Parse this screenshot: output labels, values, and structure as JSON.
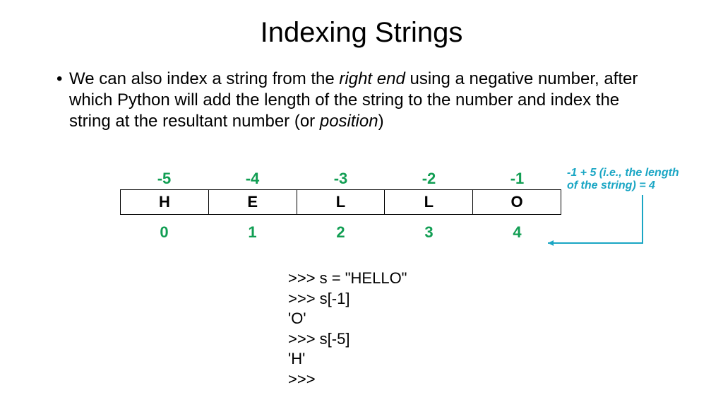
{
  "title": "Indexing Strings",
  "bullet": {
    "pre": "We can also index a string from the ",
    "em1": "right end",
    "mid": " using a negative number, after which Python will add the length of the string to the number and index the string at the resultant number (or ",
    "em2": "position",
    "post": ")"
  },
  "neg_indices": [
    "-5",
    "-4",
    "-3",
    "-2",
    "-1"
  ],
  "chars": [
    "H",
    "E",
    "L",
    "L",
    "O"
  ],
  "pos_indices": [
    "0",
    "1",
    "2",
    "3",
    "4"
  ],
  "annotation": {
    "l1": "-1 + 5 (i.e., the length",
    "l2": "of the string) = 4"
  },
  "code": {
    "l1": ">>> s = \"HELLO\"",
    "l2": ">>> s[-1]",
    "l3": "'O'",
    "l4": ">>> s[-5]",
    "l5": "'H'",
    "l6": ">>>"
  }
}
